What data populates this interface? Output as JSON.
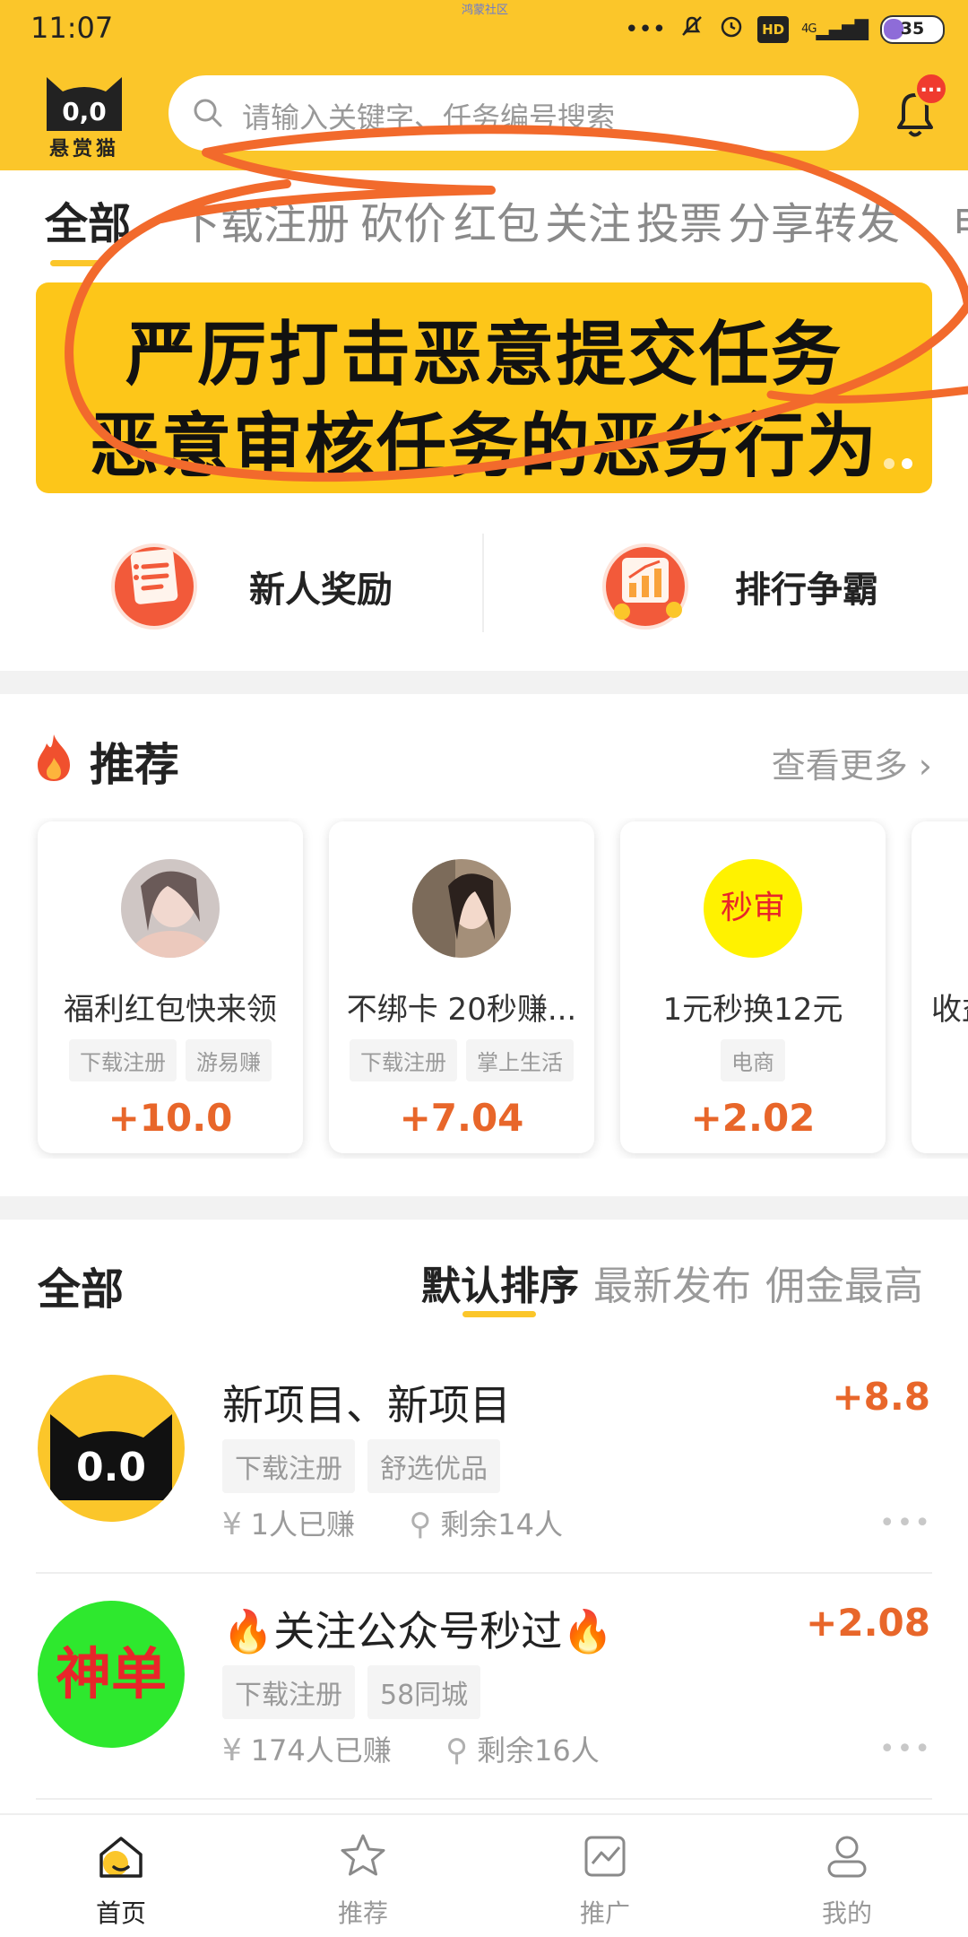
{
  "status_bar": {
    "time": "11:07",
    "watermark": "鸿蒙社区",
    "network": "4G",
    "hd": "HD",
    "battery": "35",
    "battery_level": 0.35
  },
  "header": {
    "logo_text": "悬赏猫",
    "logo_face": "0,0",
    "search_placeholder": "请输入关键字、任务编号搜索",
    "notification_badge": "..."
  },
  "category_tabs": [
    "全部",
    "下载注册",
    "砍价",
    "红包",
    "关注",
    "投票",
    "分享转发",
    "电"
  ],
  "banner": {
    "line1": "严厉打击恶意提交任务",
    "line2": "恶意审核任务的恶劣行为"
  },
  "quick_actions": [
    {
      "label": "新人奖励",
      "icon": "newcomer-reward-icon"
    },
    {
      "label": "排行争霸",
      "icon": "ranking-icon"
    }
  ],
  "recommend": {
    "title": "推荐",
    "more": "查看更多",
    "cards": [
      {
        "title": "福利红包快来领",
        "tags": [
          "下载注册",
          "游易赚"
        ],
        "reward": "+10.0",
        "avatar": "photo-avatar"
      },
      {
        "title": "不绑卡 20秒赚...",
        "tags": [
          "下载注册",
          "掌上生活"
        ],
        "reward": "+7.04",
        "avatar": "photo-avatar"
      },
      {
        "title": "1元秒换12元",
        "tags": [
          "电商"
        ],
        "reward": "+2.02",
        "avatar_text": "秒审"
      },
      {
        "title": "收益",
        "tags": [],
        "reward": "",
        "avatar": "photo-avatar"
      }
    ]
  },
  "task_list": {
    "title": "全部",
    "sorts": [
      "默认排序",
      "最新发布",
      "佣金最高"
    ],
    "items": [
      {
        "title": "新项目、新项目",
        "tags": [
          "下载注册",
          "舒选优品"
        ],
        "reward": "+8.8",
        "earned": "1人已赚",
        "remaining": "剩余14人",
        "avatar_text": "0.0"
      },
      {
        "title": "关注公众号秒过",
        "tags": [
          "下载注册",
          "58同城"
        ],
        "reward": "+2.08",
        "earned": "174人已赚",
        "remaining": "剩余16人",
        "avatar_text": "神单"
      }
    ]
  },
  "bottom_nav": [
    {
      "label": "首页",
      "icon": "home-icon",
      "active": true
    },
    {
      "label": "推荐",
      "icon": "star-icon",
      "active": false
    },
    {
      "label": "推广",
      "icon": "promote-chart-icon",
      "active": false
    },
    {
      "label": "我的",
      "icon": "profile-icon",
      "active": false
    }
  ],
  "colors": {
    "brand_yellow": "#FBC62A",
    "reward_orange": "#E8662A",
    "scribble": "#F26A2C"
  }
}
